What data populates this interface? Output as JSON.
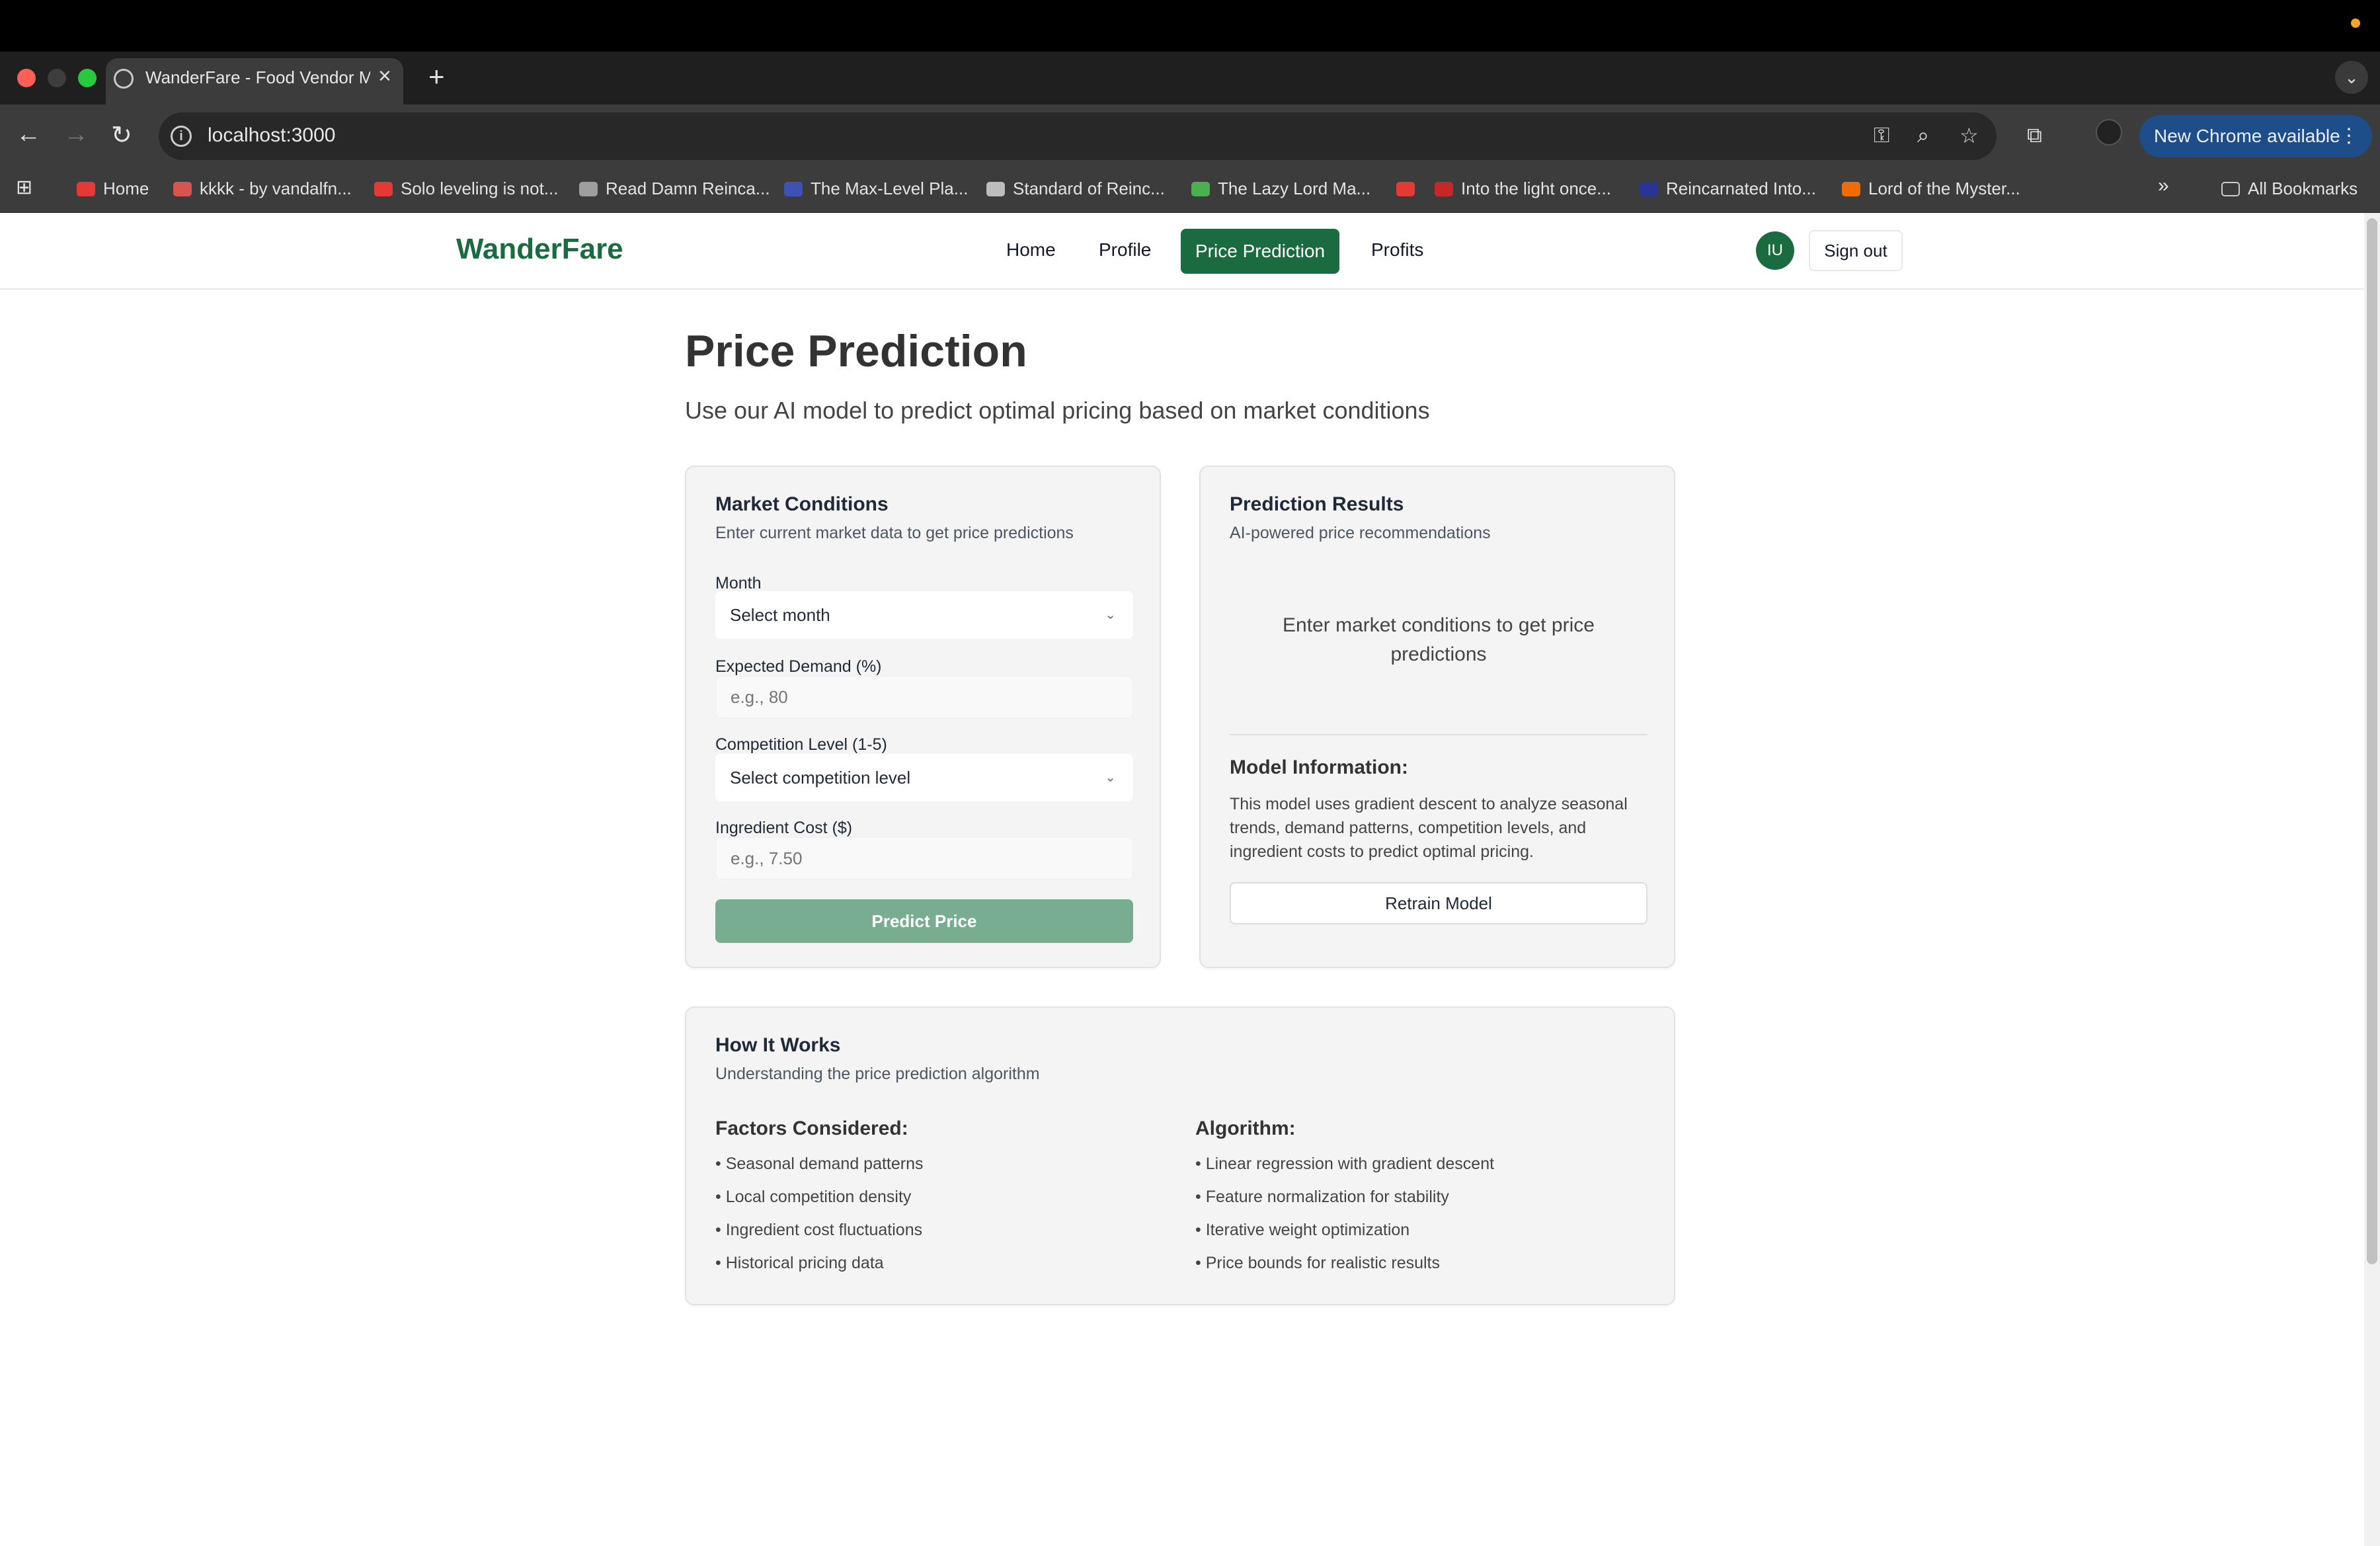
{
  "browser": {
    "tab_title": "WanderFare - Food Vendor M",
    "url": "localhost:3000",
    "update_label": "New Chrome available",
    "bookmarks": [
      {
        "label": "Home",
        "color": "#e53935"
      },
      {
        "label": "kkkk - by vandalfn...",
        "color": "#d9534f"
      },
      {
        "label": "Solo leveling is not...",
        "color": "#e53935"
      },
      {
        "label": "Read Damn Reinca...",
        "color": "#9e9e9e"
      },
      {
        "label": "The Max-Level Pla...",
        "color": "#3f51b5"
      },
      {
        "label": "Standard of Reinc...",
        "color": "#bdbdbd"
      },
      {
        "label": "The Lazy Lord Ma...",
        "color": "#4caf50"
      },
      {
        "label": "",
        "color": "#e53935"
      },
      {
        "label": "Into the light once...",
        "color": "#c62828"
      },
      {
        "label": "Reincarnated Into...",
        "color": "#283593"
      },
      {
        "label": "Lord of the Myster...",
        "color": "#ef6c00"
      }
    ],
    "all_bookmarks": "All Bookmarks"
  },
  "app": {
    "logo": "WanderFare",
    "nav": [
      "Home",
      "Profile",
      "Price Prediction",
      "Profits"
    ],
    "active_nav": "Price Prediction",
    "avatar_initials": "IU",
    "sign_out": "Sign out",
    "brand_color": "#1a6b3f"
  },
  "page": {
    "title": "Price Prediction",
    "subtitle": "Use our AI model to predict optimal pricing based on market conditions"
  },
  "market_card": {
    "title": "Market Conditions",
    "subtitle": "Enter current market data to get price predictions",
    "month_label": "Month",
    "month_value": "Select month",
    "demand_label": "Expected Demand (%)",
    "demand_placeholder": "e.g., 80",
    "competition_label": "Competition Level (1-5)",
    "competition_value": "Select competition level",
    "cost_label": "Ingredient Cost ($)",
    "cost_placeholder": "e.g., 7.50",
    "predict_button": "Predict Price"
  },
  "results_card": {
    "title": "Prediction Results",
    "subtitle": "AI-powered price recommendations",
    "empty_message": "Enter market conditions to get price predictions",
    "model_info_title": "Model Information:",
    "model_info_text": "This model uses gradient descent to analyze seasonal trends, demand patterns, competition levels, and ingredient costs to predict optimal pricing.",
    "retrain_button": "Retrain Model"
  },
  "how_card": {
    "title": "How It Works",
    "subtitle": "Understanding the price prediction algorithm",
    "factors_title": "Factors Considered:",
    "factors": [
      "• Seasonal demand patterns",
      "• Local competition density",
      "• Ingredient cost fluctuations",
      "• Historical pricing data"
    ],
    "algorithm_title": "Algorithm:",
    "algorithm": [
      "• Linear regression with gradient descent",
      "• Feature normalization for stability",
      "• Iterative weight optimization",
      "• Price bounds for realistic results"
    ]
  }
}
